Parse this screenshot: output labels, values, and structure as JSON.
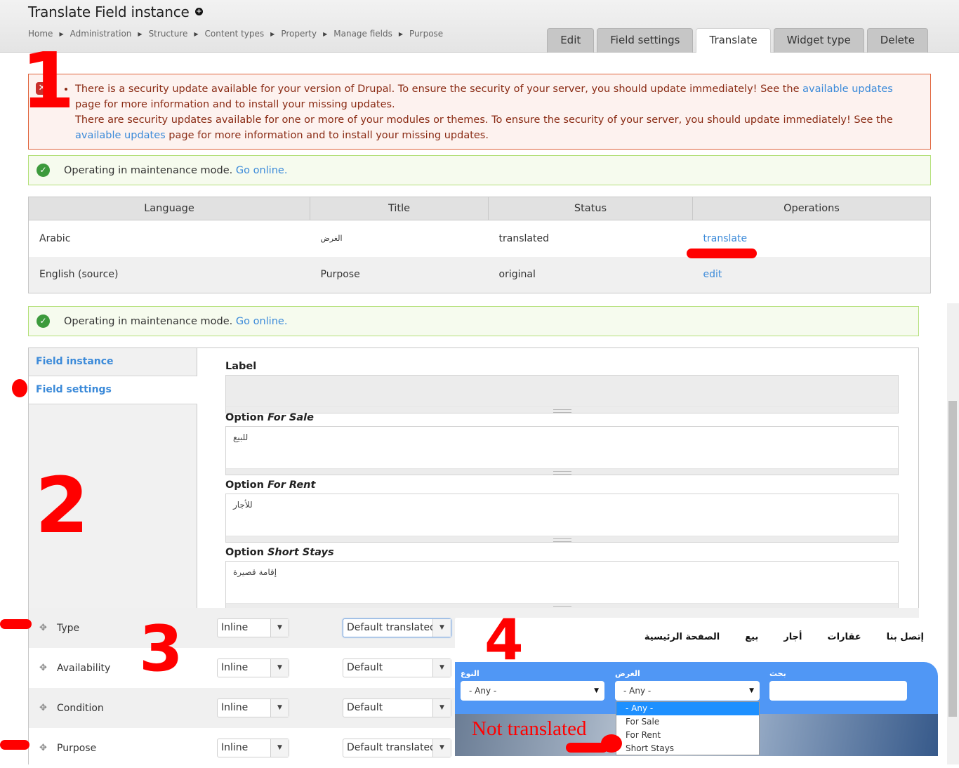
{
  "header": {
    "title": "Translate Field instance",
    "shortcut_icon": "add-shortcut-icon",
    "breadcrumb": [
      "Home",
      "Administration",
      "Structure",
      "Content types",
      "Property",
      "Manage fields",
      "Purpose"
    ],
    "tabs": [
      {
        "label": "Edit",
        "active": false
      },
      {
        "label": "Field settings",
        "active": false
      },
      {
        "label": "Translate",
        "active": true
      },
      {
        "label": "Widget type",
        "active": false
      },
      {
        "label": "Delete",
        "active": false
      }
    ]
  },
  "messages": {
    "error": {
      "icon": "error-icon",
      "line1_pre": "There is a security update available for your version of Drupal. To ensure the security of your server, you should update immediately! See the ",
      "line1_link": "available updates",
      "line1_post": " page for more information and to install your missing updates.",
      "line2_pre": "There are security updates available for one or more of your modules or themes. To ensure the security of your server, you should update immediately! See the ",
      "line2_link": "available updates",
      "line2_post": " page for more information and to install your missing updates."
    },
    "status": {
      "icon": "checkmark-icon",
      "text": "Operating in maintenance mode. ",
      "link": "Go online."
    }
  },
  "translation_table": {
    "headers": [
      "Language",
      "Title",
      "Status",
      "Operations"
    ],
    "rows": [
      {
        "language": "Arabic",
        "title": "الغرض",
        "status": "translated",
        "operation": "translate"
      },
      {
        "language": "English (source)",
        "title": "Purpose",
        "status": "original",
        "operation": "edit"
      }
    ]
  },
  "vertical_tabs": {
    "items": [
      {
        "label": "Field instance",
        "selected": false
      },
      {
        "label": "Field settings",
        "selected": true
      }
    ]
  },
  "form": {
    "label_field": {
      "label": "Label",
      "value": ""
    },
    "options": [
      {
        "prefix": "Option ",
        "name": "For Sale",
        "value": "للبيع"
      },
      {
        "prefix": "Option ",
        "name": "For Rent",
        "value": "للأجار"
      },
      {
        "prefix": "Option ",
        "name": "Short Stays",
        "value": "إقامة قصيرة"
      }
    ]
  },
  "display_settings": {
    "rows": [
      {
        "field": "Type",
        "label_display": "Inline",
        "format": "Default translated",
        "focused": true
      },
      {
        "field": "Availability",
        "label_display": "Inline",
        "format": "Default",
        "focused": false
      },
      {
        "field": "Condition",
        "label_display": "Inline",
        "format": "Default",
        "focused": false
      },
      {
        "field": "Purpose",
        "label_display": "Inline",
        "format": "Default translated",
        "focused": false
      }
    ]
  },
  "site_preview": {
    "nav": [
      "الصفحة الرئيسية",
      "بيع",
      "أجار",
      "عقارات",
      "إتصل بنا"
    ],
    "search": {
      "type_label": "النوع",
      "type_value": "- Any -",
      "purpose_label": "الغرض",
      "purpose_value": "- Any -",
      "keyword_label": "بحث",
      "keyword_value": ""
    },
    "purpose_dropdown": [
      "- Any -",
      "For Sale",
      "For Rent",
      "Short Stays"
    ],
    "purpose_dropdown_highlighted": 0
  },
  "annotations": {
    "numbers": [
      "1",
      "2",
      "3",
      "4"
    ],
    "note": "Not translated",
    "color": "#ff0000"
  }
}
